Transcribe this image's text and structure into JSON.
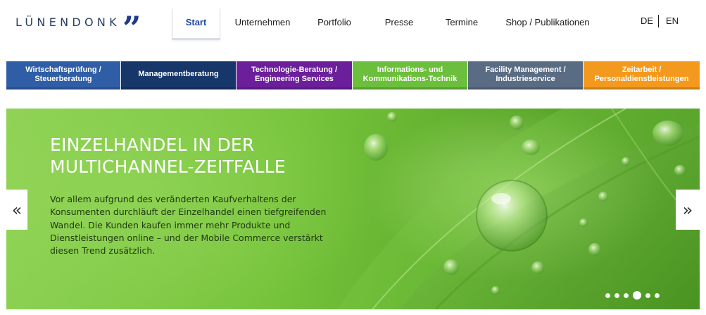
{
  "logo": {
    "text": "LÜNENDONK",
    "quote": "”"
  },
  "topnav": [
    {
      "label": "Start",
      "active": true
    },
    {
      "label": "Unternehmen"
    },
    {
      "label": "Portfolio"
    },
    {
      "label": "Presse"
    },
    {
      "label": "Termine"
    },
    {
      "label": "Shop / Publikationen"
    }
  ],
  "languages": [
    "DE",
    "EN"
  ],
  "categories": [
    {
      "label": "Wirtschaftsprüfung /\nSteuerberatung",
      "color": "#2f5ea6"
    },
    {
      "label": "Managementberatung",
      "color": "#17376a"
    },
    {
      "label": "Technologie-Beratung /\nEngineering Services",
      "color": "#6b1f9a"
    },
    {
      "label": "Informations- und\nKommunikations-Technik",
      "color": "#6cbf3c"
    },
    {
      "label": "Facility Management /\nIndustrieservice",
      "color": "#5a6c84"
    },
    {
      "label": "Zeitarbeit /\nPersonaldienstleistungen",
      "color": "#f39a1e"
    }
  ],
  "hero": {
    "title": "EINZELHANDEL IN DER\nMULTICHANNEL-ZEITFALLE",
    "text": "Vor allem aufgrund des veränderten Kaufverhaltens der Konsumenten durchläuft der Einzelhandel einen tiefgreifenden Wandel. Die Kunden kaufen immer mehr Produkte und Dienstleistungen online – und der Mobile Commerce verstärkt diesen Trend zusätzlich.",
    "prev_arrow": "«",
    "next_arrow": "»",
    "slide_count": 6,
    "active_slide": 4
  }
}
